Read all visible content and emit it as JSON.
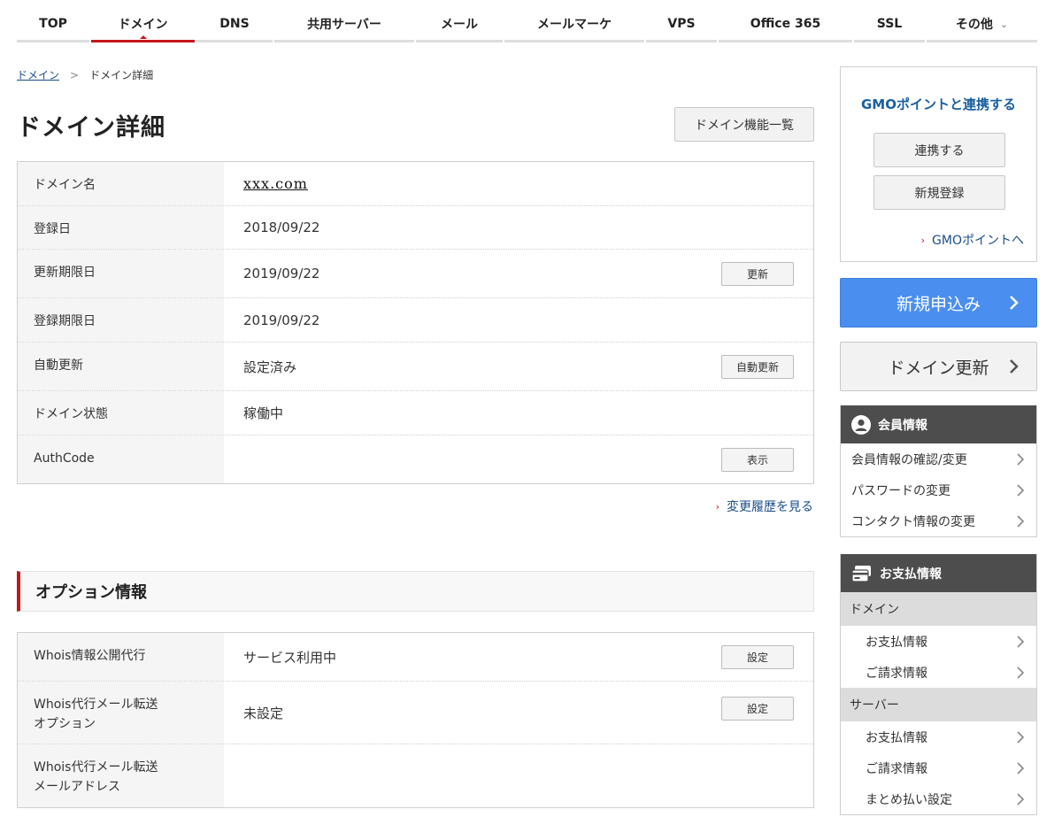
{
  "nav": {
    "tabs": [
      {
        "label": "TOP"
      },
      {
        "label": "ドメイン"
      },
      {
        "label": "DNS"
      },
      {
        "label": "共用サーバー"
      },
      {
        "label": "メール"
      },
      {
        "label": "メールマーケ"
      },
      {
        "label": "VPS"
      },
      {
        "label": "Office 365"
      },
      {
        "label": "SSL"
      },
      {
        "label": "その他"
      }
    ],
    "active_index": 1
  },
  "breadcrumb": {
    "parent": "ドメイン",
    "separator": ">",
    "current": "ドメイン詳細"
  },
  "page": {
    "title": "ドメイン詳細",
    "function_list_button": "ドメイン機能一覧"
  },
  "detail": {
    "rows": [
      {
        "label": "ドメイン名",
        "value": "xxx.com"
      },
      {
        "label": "登録日",
        "value": "2018/09/22"
      },
      {
        "label": "更新期限日",
        "value": "2019/09/22",
        "button": "更新"
      },
      {
        "label": "登録期限日",
        "value": "2019/09/22"
      },
      {
        "label": "自動更新",
        "value": "設定済み",
        "button": "自動更新"
      },
      {
        "label": "ドメイン状態",
        "value": "稼働中"
      },
      {
        "label": "AuthCode",
        "value": "",
        "button": "表示"
      }
    ]
  },
  "history_link": "変更履歴を見る",
  "options": {
    "title": "オプション情報",
    "rows": [
      {
        "label": "Whois情報公開代行",
        "value": "サービス利用中",
        "button": "設定"
      },
      {
        "label": "Whois代行メール転送\nオプション",
        "value": "未設定",
        "button": "設定"
      },
      {
        "label": "Whois代行メール転送\nメールアドレス",
        "value": ""
      }
    ]
  },
  "sidebar": {
    "gmo": {
      "title": "GMOポイントと連携する",
      "link_button": "連携する",
      "register_button": "新規登録",
      "link": "GMOポイントへ"
    },
    "new_application": "新規申込み",
    "domain_renewal": "ドメイン更新",
    "member": {
      "title": "会員情報",
      "items": [
        "会員情報の確認/変更",
        "パスワードの変更",
        "コンタクト情報の変更"
      ]
    },
    "payment": {
      "title": "お支払情報",
      "groups": [
        {
          "label": "ドメイン",
          "items": [
            "お支払情報",
            "ご請求情報"
          ]
        },
        {
          "label": "サーバー",
          "items": [
            "お支払情報",
            "ご請求情報",
            "まとめ払い設定"
          ]
        }
      ]
    }
  },
  "colors": {
    "accent_red": "#c4161c",
    "primary_blue": "#4a8ef0",
    "link_blue": "#1a4d8c",
    "panel_dark": "#4d4d4d"
  }
}
